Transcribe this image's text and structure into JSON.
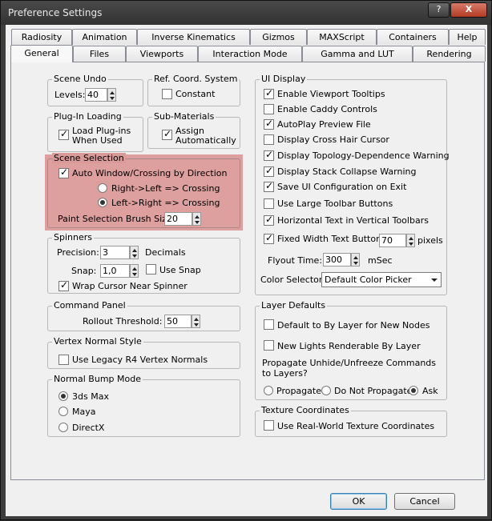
{
  "window": {
    "title": "Preference Settings",
    "help_label": "?",
    "close_label": "X"
  },
  "tabs_top": [
    "Radiosity",
    "Animation",
    "Inverse Kinematics",
    "Gizmos",
    "MAXScript",
    "Containers",
    "Help"
  ],
  "tabs_bottom": [
    "General",
    "Files",
    "Viewports",
    "Interaction Mode",
    "Gamma and LUT",
    "Rendering"
  ],
  "active_tab": "General",
  "scene_undo": {
    "title": "Scene Undo",
    "levels_label": "Levels:",
    "levels_value": "40"
  },
  "ref_coord": {
    "title": "Ref. Coord. System",
    "constant_label": "Constant",
    "constant_checked": false
  },
  "plugin_loading": {
    "title": "Plug-In Loading",
    "load_label_1": "Load Plug-ins",
    "load_label_2": "When Used",
    "checked": true
  },
  "sub_materials": {
    "title": "Sub-Materials",
    "assign_label_1": "Assign",
    "assign_label_2": "Automatically",
    "checked": true
  },
  "scene_selection": {
    "title": "Scene Selection",
    "auto_window_label": "Auto Window/Crossing by Direction",
    "auto_window_checked": true,
    "rl_label": "Right->Left => Crossing",
    "lr_label": "Left->Right => Crossing",
    "selected": "lr",
    "brush_label": "Paint Selection Brush Size",
    "brush_value": "20"
  },
  "spinners": {
    "title": "Spinners",
    "precision_label": "Precision:",
    "precision_value": "3",
    "decimals_label": "Decimals",
    "snap_label": "Snap:",
    "snap_value": "1,0",
    "use_snap_label": "Use Snap",
    "use_snap_checked": false,
    "wrap_label": "Wrap Cursor Near Spinner",
    "wrap_checked": true
  },
  "command_panel": {
    "title": "Command Panel",
    "rollout_label": "Rollout Threshold:",
    "rollout_value": "50"
  },
  "vertex_normal": {
    "title": "Vertex Normal Style",
    "legacy_label": "Use Legacy R4 Vertex Normals",
    "legacy_checked": false
  },
  "normal_bump": {
    "title": "Normal Bump Mode",
    "options": [
      "3ds Max",
      "Maya",
      "DirectX"
    ],
    "selected": "3ds Max"
  },
  "ui_display": {
    "title": "UI Display",
    "items": [
      {
        "label": "Enable Viewport Tooltips",
        "checked": true
      },
      {
        "label": "Enable Caddy Controls",
        "checked": false
      },
      {
        "label": "AutoPlay Preview File",
        "checked": true
      },
      {
        "label": "Display Cross Hair Cursor",
        "checked": false
      },
      {
        "label": "Display Topology-Dependence Warning",
        "checked": true
      },
      {
        "label": "Display Stack Collapse Warning",
        "checked": true
      },
      {
        "label": "Save UI Configuration on Exit",
        "checked": true
      },
      {
        "label": "Use Large Toolbar Buttons",
        "checked": false
      },
      {
        "label": "Horizontal Text in Vertical Toolbars",
        "checked": true
      }
    ],
    "fixed_width_label": "Fixed Width Text Buttons:",
    "fixed_width_checked": true,
    "fixed_width_value": "70",
    "pixels_label": "pixels",
    "flyout_label": "Flyout Time:",
    "flyout_value": "300",
    "msec_label": "mSec",
    "color_selector_label": "Color Selector:",
    "color_selector_value": "Default Color Picker"
  },
  "layer_defaults": {
    "title": "Layer Defaults",
    "default_by_layer_label": "Default to By Layer for New Nodes",
    "default_by_layer_checked": false,
    "new_lights_label": "New Lights Renderable By Layer",
    "new_lights_checked": false,
    "propagate_text_1": "Propagate Unhide/Unfreeze Commands",
    "propagate_text_2": "to Layers?",
    "options": [
      "Propagate",
      "Do Not Propagate",
      "Ask"
    ],
    "selected": "Ask"
  },
  "texture_coords": {
    "title": "Texture Coordinates",
    "real_world_label": "Use Real-World Texture Coordinates",
    "checked": false
  },
  "buttons": {
    "ok": "OK",
    "cancel": "Cancel"
  },
  "colors": {
    "highlight": "#c83c3c",
    "titlebar": "#3d3d3d",
    "close": "#c24a30"
  },
  "icons": {
    "check": "checkmark-icon",
    "radio": "radio-dot-icon",
    "spinner": "spinner-arrows-icon",
    "dropdown": "chevron-down-icon"
  }
}
